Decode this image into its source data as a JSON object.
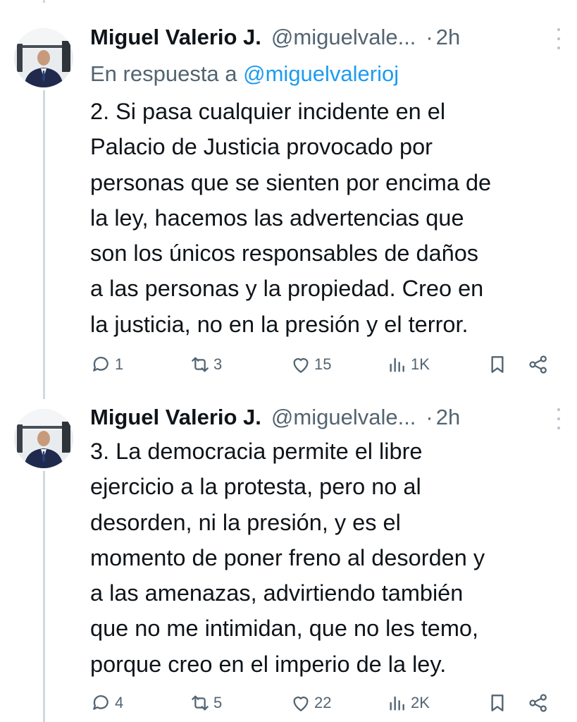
{
  "tweets": [
    {
      "author_name": "Miguel Valerio J.",
      "handle": "@miguelvale...",
      "separator": "·",
      "time": "2h",
      "reply_prefix": "En respuesta a ",
      "reply_handle": "@miguelvalerioj",
      "text": "2. Si pasa cualquier incidente en el\nPalacio de Justicia provocado por\npersonas que se sienten por encima de\nla ley, hacemos las advertencias que\nson los únicos responsables de daños\na las personas y la propiedad. Creo en\nla justicia, no en la presión y el terror.",
      "replies": "1",
      "retweets": "3",
      "likes": "15",
      "views": "1K"
    },
    {
      "author_name": "Miguel Valerio J.",
      "handle": "@miguelvale...",
      "separator": "·",
      "time": "2h",
      "text": "3. La democracia permite el libre\nejercicio a la protesta, pero no al\ndesorden, ni la presión, y es el\nmomento de poner freno al desorden y\na las amenazas, advirtiendo también\nque no me intimidan, que no les temo,\nporque creo en el imperio de la ley.",
      "replies": "4",
      "retweets": "5",
      "likes": "22",
      "views": "2K"
    }
  ],
  "icons": {
    "reply": "reply-icon",
    "retweet": "retweet-icon",
    "like": "heart-icon",
    "views": "views-icon",
    "bookmark": "bookmark-icon",
    "share": "share-icon",
    "more": "more-vertical-icon"
  },
  "colors": {
    "text": "#0f1419",
    "secondary": "#536471",
    "link": "#1d9bf0",
    "thread_line": "#cfd9de"
  }
}
